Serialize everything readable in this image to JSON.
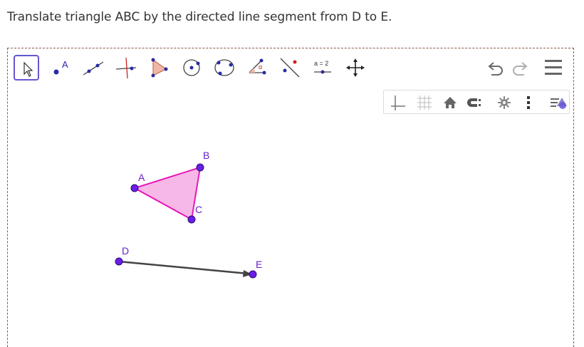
{
  "question": "Translate triangle ABC by the directed line segment from D to E.",
  "toolbar": {
    "tools": [
      {
        "name": "move-tool",
        "active": true
      },
      {
        "name": "point-tool",
        "label": "A"
      },
      {
        "name": "line-tool"
      },
      {
        "name": "perpendicular-line-tool"
      },
      {
        "name": "polygon-tool"
      },
      {
        "name": "circle-center-point-tool"
      },
      {
        "name": "circle-three-points-tool"
      },
      {
        "name": "angle-tool"
      },
      {
        "name": "reflect-tool"
      },
      {
        "name": "slider-tool",
        "label": "a = 2"
      },
      {
        "name": "move-graphics-view-tool"
      }
    ]
  },
  "points": {
    "A": {
      "label": "A"
    },
    "B": {
      "label": "B"
    },
    "C": {
      "label": "C"
    },
    "D": {
      "label": "D"
    },
    "E": {
      "label": "E"
    }
  },
  "colors": {
    "accent": "#6557d2",
    "point_fill": "#6a1ee6",
    "polygon_stroke": "#e617b9",
    "polygon_fill": "#f6b8e6",
    "segment": "#444444"
  }
}
